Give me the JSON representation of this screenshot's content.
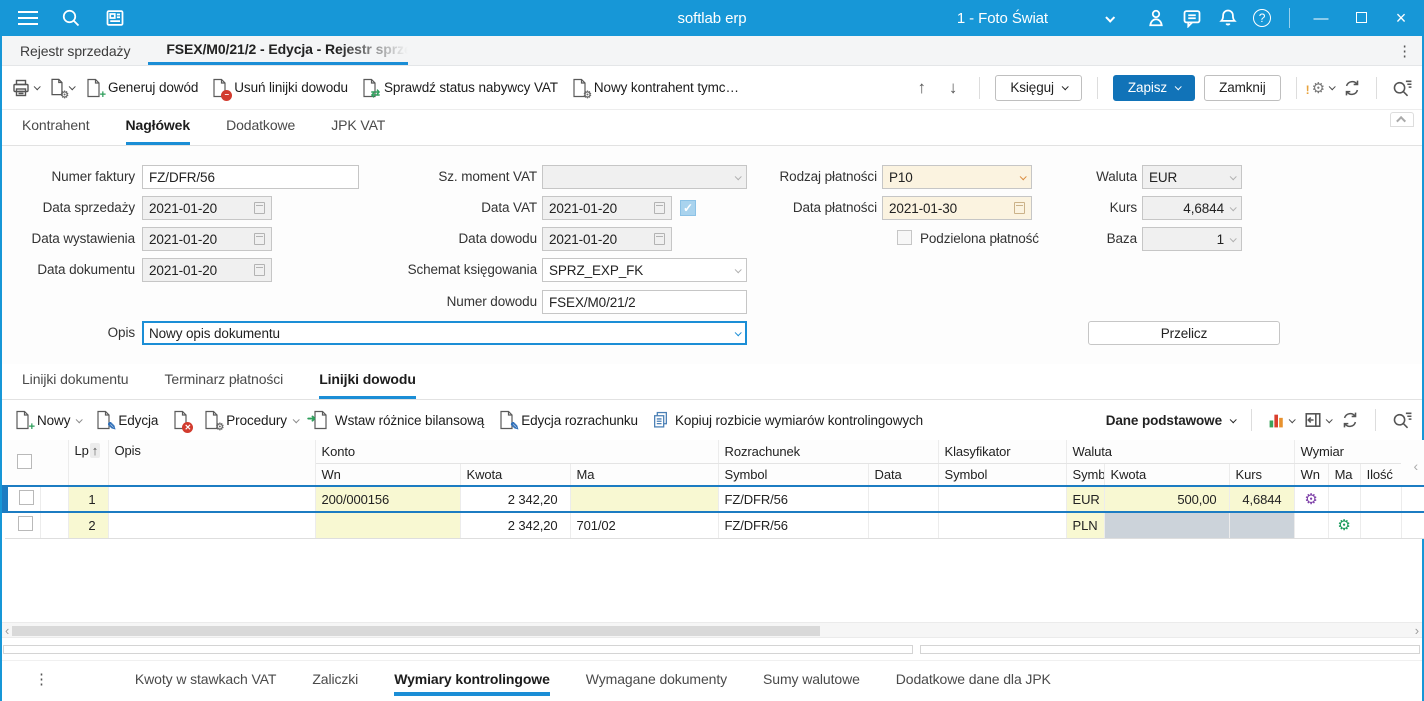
{
  "colors": {
    "titlebar": "#1797d7",
    "accent": "#1b8ed6",
    "save_button": "#1173b8",
    "selected_row_border": "#1c7cc2",
    "cell_yellow": "#f8f8d2",
    "cell_gray": "#ccd3da",
    "field_cream": "#fbf3e0",
    "gear_purple": "#7d3fa8",
    "gear_green": "#199a5a"
  },
  "titlebar": {
    "app_title": "softlab erp",
    "company": "1 - Foto Świat"
  },
  "window_controls": {
    "minimize": "—",
    "close": "×"
  },
  "misc": {
    "kebab": "⋮",
    "scroll_left": "‹",
    "scroll_right": "›",
    "side_collapse": "‹"
  },
  "doc_tabs": {
    "list_tab": "Rejestr sprzedaży",
    "edit_tab": "FSEX/M0/21/2 - Edycja - Rejestr sprze"
  },
  "main_toolbar": {
    "generate_proof": "Generuj dowód",
    "delete_proof_lines": "Usuń linijki dowodu",
    "check_vat_status": "Sprawdź status nabywcy VAT",
    "new_temp_contractor": "Nowy kontrahent tymc…",
    "move_up": "↑",
    "move_down": "↓",
    "post": "Księguj",
    "save": "Zapisz",
    "close": "Zamknij"
  },
  "form_tabs": {
    "contractor": "Kontrahent",
    "header": "Nagłówek",
    "additional": "Dodatkowe",
    "jpk": "JPK VAT"
  },
  "form": {
    "invoice_number": {
      "label": "Numer faktury",
      "value": "FZ/DFR/56"
    },
    "sale_date": {
      "label": "Data sprzedaży",
      "value": "2021-01-20"
    },
    "issue_date": {
      "label": "Data wystawienia",
      "value": "2021-01-20"
    },
    "document_date": {
      "label": "Data dokumentu",
      "value": "2021-01-20"
    },
    "vat_moment": {
      "label": "Sz. moment VAT",
      "value": ""
    },
    "vat_date": {
      "label": "Data VAT",
      "value": "2021-01-20",
      "checked": "✓"
    },
    "proof_date": {
      "label": "Data dowodu",
      "value": "2021-01-20"
    },
    "posting_scheme": {
      "label": "Schemat księgowania",
      "value": "SPRZ_EXP_FK"
    },
    "proof_number": {
      "label": "Numer dowodu",
      "value": "FSEX/M0/21/2"
    },
    "description": {
      "label": "Opis",
      "value": "Nowy opis dokumentu"
    },
    "payment_type": {
      "label": "Rodzaj płatności",
      "value": "P10"
    },
    "payment_date": {
      "label": "Data płatności",
      "value": "2021-01-30"
    },
    "split_payment_label": "Podzielona płatność",
    "currency": {
      "label": "Waluta",
      "value": "EUR"
    },
    "exchange_rate": {
      "label": "Kurs",
      "value": "4,6844"
    },
    "base": {
      "label": "Baza",
      "value": "1"
    },
    "recalculate": "Przelicz"
  },
  "section_tabs": {
    "document_lines": "Linijki dokumentu",
    "payment_schedule": "Terminarz płatności",
    "proof_lines": "Linijki dowodu"
  },
  "lines_toolbar": {
    "new": "Nowy",
    "edit": "Edycja",
    "procedures": "Procedury",
    "insert_balance_diff": "Wstaw różnice bilansową",
    "edit_settlement": "Edycja rozrachunku",
    "copy_dimension_split": "Kopiuj rozbicie wymiarów kontrolingowych",
    "view_selector": "Dane podstawowe"
  },
  "table": {
    "sort_arrow": "↑",
    "groups": {
      "konto": "Konto",
      "rozrachunek": "Rozrachunek",
      "klasyfikator": "Klasyfikator",
      "waluta": "Waluta",
      "wymiar": "Wymiar"
    },
    "cols": {
      "lp": "Lp",
      "opis": "Opis",
      "konto_wn": "Wn",
      "konto_kwota": "Kwota",
      "konto_ma": "Ma",
      "roz_symbol": "Symbol",
      "roz_data": "Data",
      "klas_symbol": "Symbol",
      "wal_symbol": "Symbol",
      "wal_kwota": "Kwota",
      "wal_kurs": "Kurs",
      "wym_wn": "Wn",
      "wym_ma": "Ma",
      "wym_ilosc": "Ilość"
    },
    "rows": [
      {
        "lp": "1",
        "opis": "",
        "konto_wn": "200/000156",
        "konto_kwota": "2 342,20",
        "konto_ma": "",
        "roz_symbol": "FZ/DFR/56",
        "roz_data": "",
        "klas_symbol": "",
        "wal_symbol": "EUR",
        "wal_kwota": "500,00",
        "wal_kurs": "4,6844",
        "wym_wn_icon": "⚙",
        "wym_ma_icon": "",
        "wym_ilosc": ""
      },
      {
        "lp": "2",
        "opis": "",
        "konto_wn": "",
        "konto_kwota": "2 342,20",
        "konto_ma": "701/02",
        "roz_symbol": "FZ/DFR/56",
        "roz_data": "",
        "klas_symbol": "",
        "wal_symbol": "PLN",
        "wal_kwota": "",
        "wal_kurs": "",
        "wym_wn_icon": "",
        "wym_ma_icon": "⚙",
        "wym_ilosc": ""
      }
    ]
  },
  "bottom_tabs": {
    "vat_rates": "Kwoty w stawkach VAT",
    "advances": "Zaliczki",
    "controlling_dimensions": "Wymiary kontrolingowe",
    "required_documents": "Wymagane dokumenty",
    "currency_totals": "Sumy walutowe",
    "jpk_additional": "Dodatkowe dane dla JPK"
  }
}
